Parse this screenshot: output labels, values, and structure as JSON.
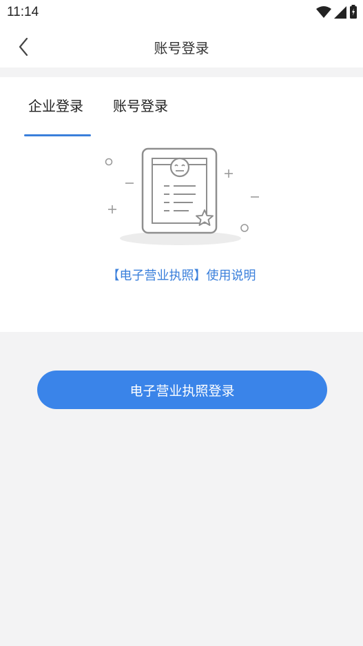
{
  "status_bar": {
    "time": "11:14",
    "icons": [
      "wifi-icon",
      "signal-icon",
      "battery-icon"
    ]
  },
  "nav": {
    "title": "账号登录",
    "back_icon": "chevron-left-icon"
  },
  "tabs": [
    {
      "label": "企业登录",
      "active": true
    },
    {
      "label": "账号登录",
      "active": false
    }
  ],
  "illustration": {
    "icon": "business-license-icon"
  },
  "help_link": "【电子营业执照】使用说明",
  "login_button": "电子营业执照登录",
  "colors": {
    "accent": "#3a84e9",
    "link": "#3a7fdb",
    "background": "#f3f3f4"
  }
}
